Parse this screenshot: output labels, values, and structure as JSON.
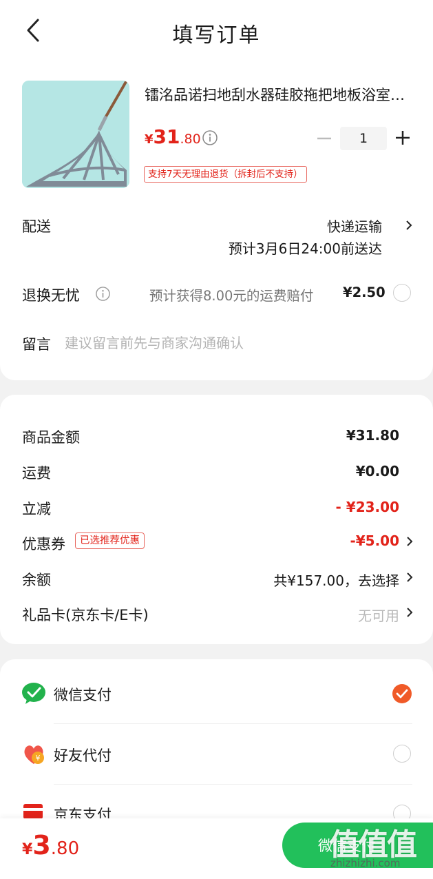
{
  "header": {
    "title": "填写订单"
  },
  "product": {
    "title": "镭洺品诺扫地刮水器硅胶拖把地板浴室刮水神器",
    "price_yen": "¥",
    "price_int": "31",
    "price_dec": ".80",
    "quantity": "1",
    "return_tag": "支持7天无理由退货（拆封后不支持）"
  },
  "delivery": {
    "label": "配送",
    "method": "快递运输",
    "eta": "预计3月6日24:00前送达"
  },
  "worry_free": {
    "label": "退换无忧",
    "desc": "预计获得8.00元的运费赔付",
    "price": "¥2.50"
  },
  "message": {
    "label": "留言",
    "placeholder": "建议留言前先与商家沟通确认"
  },
  "amounts": {
    "goods_label": "商品金额",
    "goods_value": "¥31.80",
    "shipping_label": "运费",
    "shipping_value": "¥0.00",
    "discount_label": "立减",
    "discount_value": "- ¥23.00",
    "coupon_label": "优惠券",
    "coupon_tag": "已选推荐优惠",
    "coupon_value": "-¥5.00",
    "balance_label": "余额",
    "balance_value": "共¥157.00，去选择",
    "giftcard_label": "礼品卡(京东卡/E卡)",
    "giftcard_value": "无可用"
  },
  "payment": {
    "wechat_label": "微信支付",
    "friend_label": "好友代付",
    "jd_label": "京东支付"
  },
  "bottom": {
    "total_yen": "¥",
    "total_int": "3",
    "total_dec": ".80",
    "pay_button": "微信支付"
  },
  "watermark": {
    "big": "值值值",
    "small": "zhizhizhi.com"
  },
  "colors": {
    "accent_red": "#e2231a",
    "wechat_green": "#22c05b",
    "check_orange": "#f05a28"
  }
}
